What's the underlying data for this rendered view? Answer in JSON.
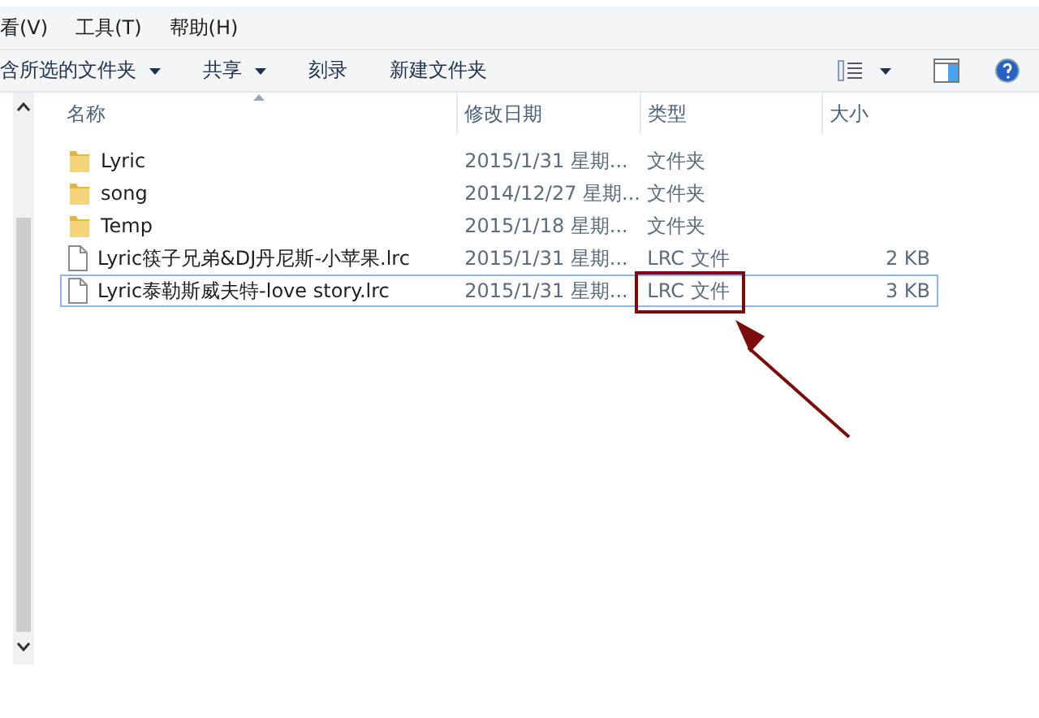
{
  "menu": [
    {
      "label": "看(V)"
    },
    {
      "label": "工具(T)"
    },
    {
      "label": "帮助(H)"
    }
  ],
  "toolbar": [
    {
      "label": "含所选的文件夹",
      "dropdown": true
    },
    {
      "label": "共享",
      "dropdown": true
    },
    {
      "label": "刻录",
      "dropdown": false
    },
    {
      "label": "新建文件夹",
      "dropdown": false
    }
  ],
  "columns": [
    {
      "label": "名称",
      "sorted": true
    },
    {
      "label": "修改日期",
      "sorted": false
    },
    {
      "label": "类型",
      "sorted": false
    },
    {
      "label": "大小",
      "sorted": false
    }
  ],
  "rows": [
    {
      "kind": "folder",
      "name": "Lyric",
      "date": "2015/1/31 星期...",
      "type": "文件夹",
      "selected": false
    },
    {
      "kind": "folder",
      "name": "song",
      "date": "2014/12/27 星期...",
      "type": "文件夹",
      "selected": false
    },
    {
      "kind": "folder",
      "name": "Temp",
      "date": "2015/1/18 星期...",
      "type": "文件夹",
      "selected": false
    },
    {
      "kind": "file",
      "name": "Lyric筷子兄弟&DJ丹尼斯-小苹果.lrc",
      "date": "2015/1/31 星期...",
      "type": "LRC 文件",
      "size": "2 KB",
      "selected": false
    },
    {
      "kind": "file",
      "name": "Lyric泰勒斯威夫特-love story.lrc",
      "date": "2015/1/31 星期...",
      "type": "LRC 文件",
      "size": "3 KB",
      "selected": true
    }
  ]
}
